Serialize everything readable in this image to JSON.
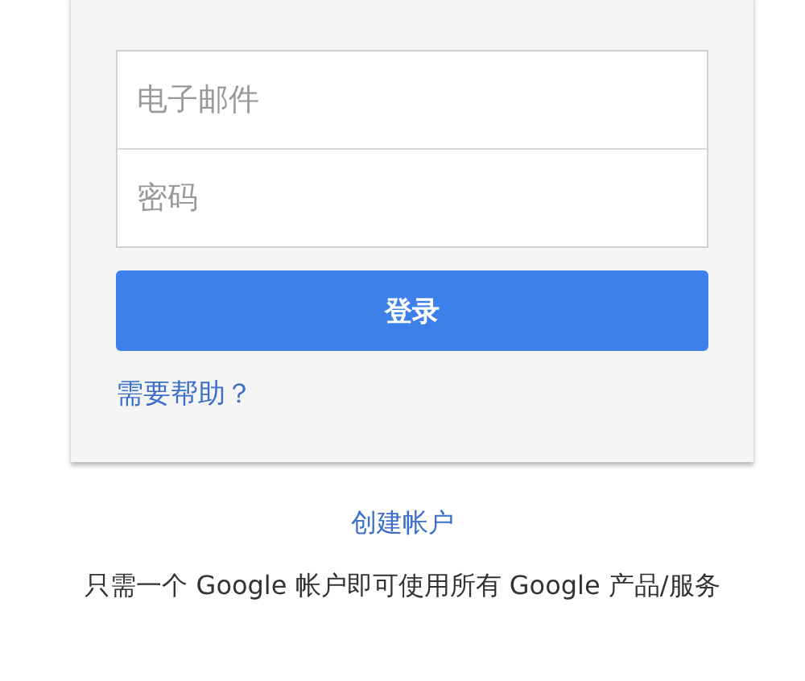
{
  "form": {
    "email": {
      "placeholder": "电子邮件"
    },
    "password": {
      "placeholder": "密码"
    },
    "sign_in_button": "登录",
    "help_link": "需要帮助？"
  },
  "create_account_link": "创建帐户",
  "tagline": "只需一个 Google 帐户即可使用所有 Google 产品/服务"
}
